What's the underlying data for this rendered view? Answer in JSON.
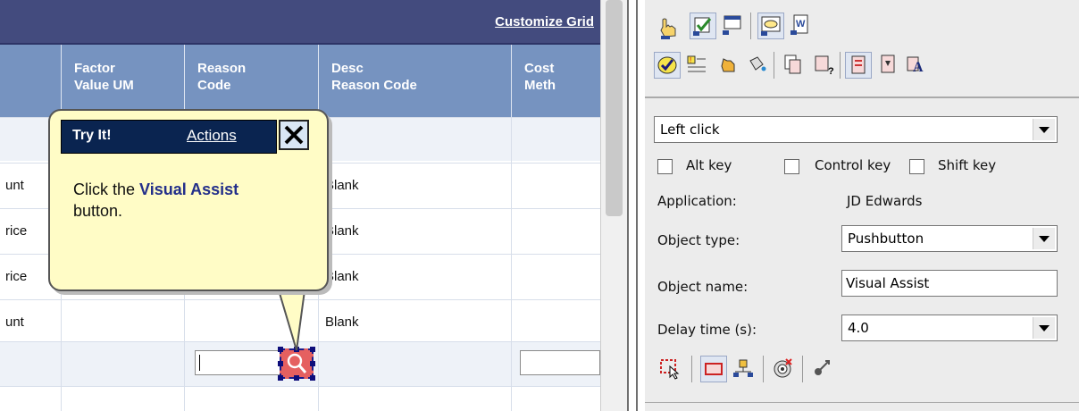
{
  "grid": {
    "customize_label": "Customize Grid",
    "columns": [
      {
        "l1": "Factor",
        "l2": "Value UM"
      },
      {
        "l1": "Reason",
        "l2": "Code"
      },
      {
        "l1": "Desc",
        "l2": "Reason Code"
      },
      {
        "l1": "Cost",
        "l2": "Meth"
      }
    ],
    "rows": [
      {
        "c0": "",
        "desc": ""
      },
      {
        "c0": "unt",
        "desc": "Blank"
      },
      {
        "c0": "rice",
        "desc": "Blank"
      },
      {
        "c0": "rice",
        "desc": "Blank"
      },
      {
        "c0": "unt",
        "desc": "Blank"
      }
    ]
  },
  "callout": {
    "title": "Try It!",
    "actions": "Actions",
    "msg_pre": "Click the ",
    "msg_bold": "Visual Assist",
    "msg_post": " button."
  },
  "panel": {
    "action_select": "Left click",
    "alt_key": "Alt key",
    "control_key": "Control key",
    "shift_key": "Shift key",
    "application_label": "Application:",
    "application_value": "JD Edwards",
    "object_type_label": "Object type:",
    "object_type_value": "Pushbutton",
    "object_name_label": "Object name:",
    "object_name_value": "Visual Assist",
    "delay_label": "Delay time (s):",
    "delay_value": "4.0"
  }
}
